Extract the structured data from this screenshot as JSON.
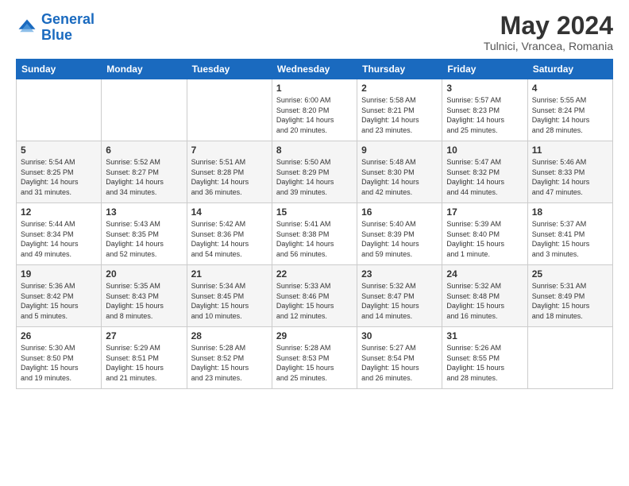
{
  "header": {
    "logo_line1": "General",
    "logo_line2": "Blue",
    "month_title": "May 2024",
    "location": "Tulnici, Vrancea, Romania"
  },
  "weekdays": [
    "Sunday",
    "Monday",
    "Tuesday",
    "Wednesday",
    "Thursday",
    "Friday",
    "Saturday"
  ],
  "weeks": [
    [
      {
        "day": "",
        "info": ""
      },
      {
        "day": "",
        "info": ""
      },
      {
        "day": "",
        "info": ""
      },
      {
        "day": "1",
        "info": "Sunrise: 6:00 AM\nSunset: 8:20 PM\nDaylight: 14 hours\nand 20 minutes."
      },
      {
        "day": "2",
        "info": "Sunrise: 5:58 AM\nSunset: 8:21 PM\nDaylight: 14 hours\nand 23 minutes."
      },
      {
        "day": "3",
        "info": "Sunrise: 5:57 AM\nSunset: 8:23 PM\nDaylight: 14 hours\nand 25 minutes."
      },
      {
        "day": "4",
        "info": "Sunrise: 5:55 AM\nSunset: 8:24 PM\nDaylight: 14 hours\nand 28 minutes."
      }
    ],
    [
      {
        "day": "5",
        "info": "Sunrise: 5:54 AM\nSunset: 8:25 PM\nDaylight: 14 hours\nand 31 minutes."
      },
      {
        "day": "6",
        "info": "Sunrise: 5:52 AM\nSunset: 8:27 PM\nDaylight: 14 hours\nand 34 minutes."
      },
      {
        "day": "7",
        "info": "Sunrise: 5:51 AM\nSunset: 8:28 PM\nDaylight: 14 hours\nand 36 minutes."
      },
      {
        "day": "8",
        "info": "Sunrise: 5:50 AM\nSunset: 8:29 PM\nDaylight: 14 hours\nand 39 minutes."
      },
      {
        "day": "9",
        "info": "Sunrise: 5:48 AM\nSunset: 8:30 PM\nDaylight: 14 hours\nand 42 minutes."
      },
      {
        "day": "10",
        "info": "Sunrise: 5:47 AM\nSunset: 8:32 PM\nDaylight: 14 hours\nand 44 minutes."
      },
      {
        "day": "11",
        "info": "Sunrise: 5:46 AM\nSunset: 8:33 PM\nDaylight: 14 hours\nand 47 minutes."
      }
    ],
    [
      {
        "day": "12",
        "info": "Sunrise: 5:44 AM\nSunset: 8:34 PM\nDaylight: 14 hours\nand 49 minutes."
      },
      {
        "day": "13",
        "info": "Sunrise: 5:43 AM\nSunset: 8:35 PM\nDaylight: 14 hours\nand 52 minutes."
      },
      {
        "day": "14",
        "info": "Sunrise: 5:42 AM\nSunset: 8:36 PM\nDaylight: 14 hours\nand 54 minutes."
      },
      {
        "day": "15",
        "info": "Sunrise: 5:41 AM\nSunset: 8:38 PM\nDaylight: 14 hours\nand 56 minutes."
      },
      {
        "day": "16",
        "info": "Sunrise: 5:40 AM\nSunset: 8:39 PM\nDaylight: 14 hours\nand 59 minutes."
      },
      {
        "day": "17",
        "info": "Sunrise: 5:39 AM\nSunset: 8:40 PM\nDaylight: 15 hours\nand 1 minute."
      },
      {
        "day": "18",
        "info": "Sunrise: 5:37 AM\nSunset: 8:41 PM\nDaylight: 15 hours\nand 3 minutes."
      }
    ],
    [
      {
        "day": "19",
        "info": "Sunrise: 5:36 AM\nSunset: 8:42 PM\nDaylight: 15 hours\nand 5 minutes."
      },
      {
        "day": "20",
        "info": "Sunrise: 5:35 AM\nSunset: 8:43 PM\nDaylight: 15 hours\nand 8 minutes."
      },
      {
        "day": "21",
        "info": "Sunrise: 5:34 AM\nSunset: 8:45 PM\nDaylight: 15 hours\nand 10 minutes."
      },
      {
        "day": "22",
        "info": "Sunrise: 5:33 AM\nSunset: 8:46 PM\nDaylight: 15 hours\nand 12 minutes."
      },
      {
        "day": "23",
        "info": "Sunrise: 5:32 AM\nSunset: 8:47 PM\nDaylight: 15 hours\nand 14 minutes."
      },
      {
        "day": "24",
        "info": "Sunrise: 5:32 AM\nSunset: 8:48 PM\nDaylight: 15 hours\nand 16 minutes."
      },
      {
        "day": "25",
        "info": "Sunrise: 5:31 AM\nSunset: 8:49 PM\nDaylight: 15 hours\nand 18 minutes."
      }
    ],
    [
      {
        "day": "26",
        "info": "Sunrise: 5:30 AM\nSunset: 8:50 PM\nDaylight: 15 hours\nand 19 minutes."
      },
      {
        "day": "27",
        "info": "Sunrise: 5:29 AM\nSunset: 8:51 PM\nDaylight: 15 hours\nand 21 minutes."
      },
      {
        "day": "28",
        "info": "Sunrise: 5:28 AM\nSunset: 8:52 PM\nDaylight: 15 hours\nand 23 minutes."
      },
      {
        "day": "29",
        "info": "Sunrise: 5:28 AM\nSunset: 8:53 PM\nDaylight: 15 hours\nand 25 minutes."
      },
      {
        "day": "30",
        "info": "Sunrise: 5:27 AM\nSunset: 8:54 PM\nDaylight: 15 hours\nand 26 minutes."
      },
      {
        "day": "31",
        "info": "Sunrise: 5:26 AM\nSunset: 8:55 PM\nDaylight: 15 hours\nand 28 minutes."
      },
      {
        "day": "",
        "info": ""
      }
    ]
  ]
}
